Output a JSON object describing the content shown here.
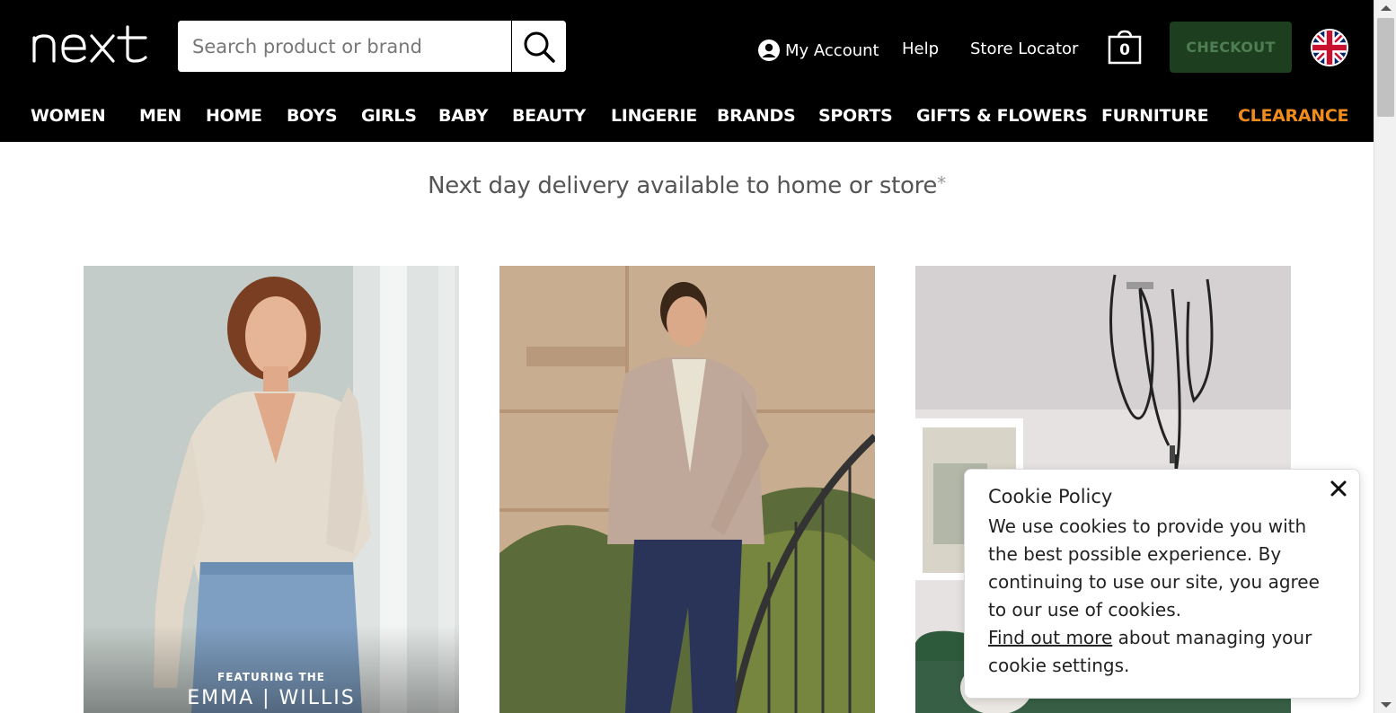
{
  "header": {
    "logo_alt": "next",
    "search": {
      "placeholder": "Search product or brand",
      "value": ""
    },
    "search_icon": "magnifier-icon",
    "my_account": "My Account",
    "help": "Help",
    "store_locator": "Store Locator",
    "bag_count": "0",
    "checkout": "CHECKOUT",
    "flag_icon": "uk-flag-icon"
  },
  "nav": {
    "items": [
      "WOMEN",
      "MEN",
      "HOME",
      "BOYS",
      "GIRLS",
      "BABY",
      "BEAUTY",
      "LINGERIE",
      "BRANDS",
      "SPORTS",
      "GIFTS & FLOWERS",
      "FURNITURE",
      "CLEARANCE"
    ],
    "clearance_color": "#f08c1c"
  },
  "delivery_banner": {
    "text": "Next day delivery available to home or store",
    "asterisk": "*"
  },
  "tiles": [
    {
      "caption_line1": "FEATURING THE",
      "caption_line2": "EMMA | WILLIS"
    },
    {},
    {}
  ],
  "cookie": {
    "title": "Cookie Policy",
    "body": "We use cookies to provide you with the best possible experience. By continuing to use our site, you agree to our use of cookies.",
    "link": "Find out more",
    "link_suffix": " about managing your cookie settings.",
    "close_icon": "close-icon"
  },
  "colors": {
    "header_bg": "#000000",
    "checkout_bg": "#1d3f20",
    "checkout_text": "#4f7e52",
    "clearance": "#f08c1c"
  }
}
